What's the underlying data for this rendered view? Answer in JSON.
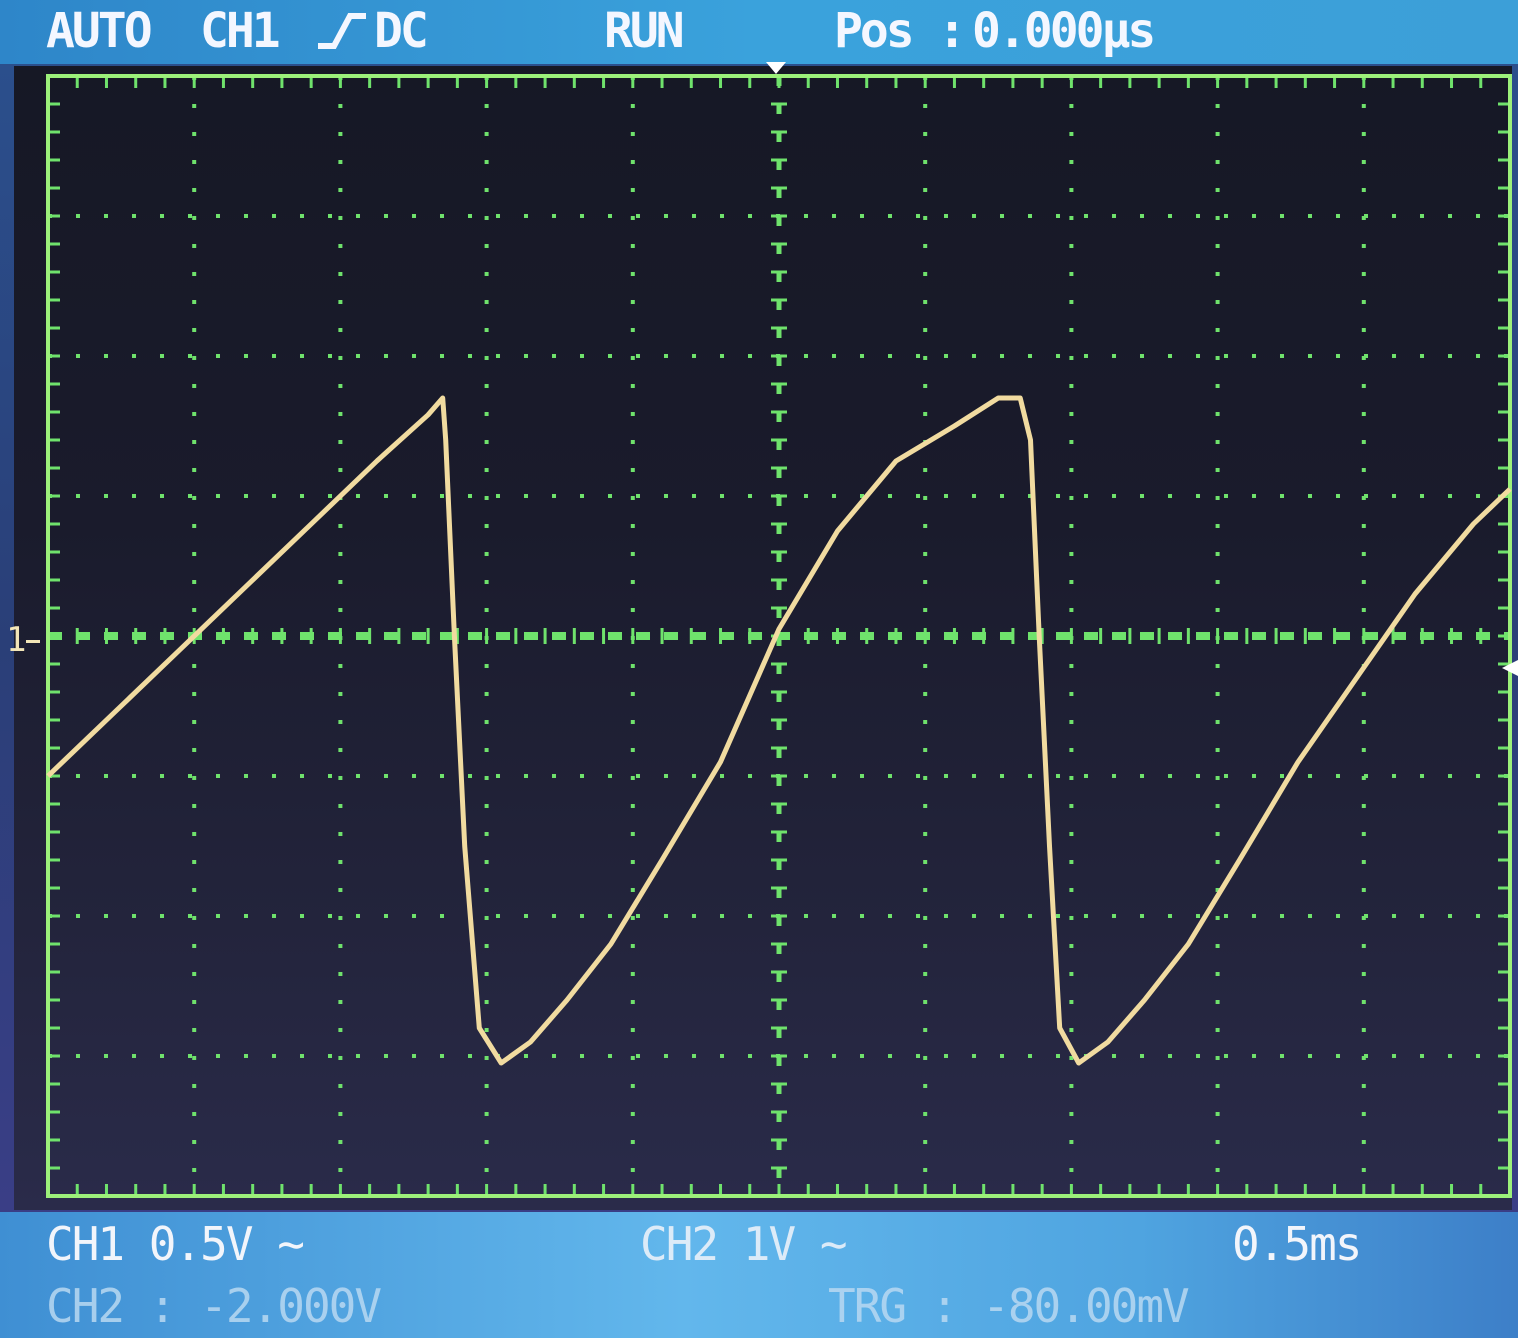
{
  "header": {
    "mode": "AUTO",
    "trigger_source": "CH1",
    "trigger_slope_icon": "rising-edge-icon",
    "coupling": "DC",
    "run_state": "RUN",
    "position_label": "Pos :",
    "position_value": "0.000µs"
  },
  "footer": {
    "ch1_scale": "CH1 0.5V ∼",
    "ch2_scale": "CH2 1V ∼",
    "timebase": "0.5ms",
    "ch2_offset": "CH2 : -2.000V",
    "trigger_level": "TRG : -80.00mV"
  },
  "markers": {
    "ch1_ground": "1"
  },
  "colors": {
    "grid": "#6fe26c",
    "border": "#9cf07a",
    "trace": "#f1dba0",
    "header_bg": "#3aa2dc",
    "footer_bg": "#62b7ec"
  },
  "chart_data": {
    "type": "line",
    "title": "",
    "xlabel": "",
    "ylabel": "",
    "x_unit": "div",
    "y_unit": "div",
    "xlim": [
      0,
      10
    ],
    "ylim": [
      -4,
      4
    ],
    "grid": true,
    "series": [
      {
        "x": [
          0,
          0.45,
          0.9,
          1.35,
          1.8,
          2.25,
          2.6,
          2.7,
          2.72,
          2.78,
          2.85,
          2.95,
          3.1,
          3.3,
          3.55,
          3.85,
          4.2,
          4.6,
          5.0,
          5.4,
          5.8,
          6.2,
          6.5,
          6.65,
          6.72,
          6.78,
          6.85,
          6.92,
          7.05,
          7.25,
          7.5,
          7.8,
          8.15,
          8.55,
          8.95,
          9.35,
          9.75,
          10.0
        ],
        "y": [
          -1.0,
          -0.55,
          -0.1,
          0.35,
          0.8,
          1.25,
          1.58,
          1.7,
          1.4,
          0.0,
          -1.5,
          -2.8,
          -3.05,
          -2.9,
          -2.6,
          -2.2,
          -1.6,
          -0.9,
          0.05,
          0.75,
          1.25,
          1.5,
          1.7,
          1.7,
          1.4,
          0.0,
          -1.5,
          -2.8,
          -3.05,
          -2.9,
          -2.6,
          -2.2,
          -1.6,
          -0.9,
          -0.3,
          0.3,
          0.8,
          1.05
        ]
      }
    ]
  }
}
